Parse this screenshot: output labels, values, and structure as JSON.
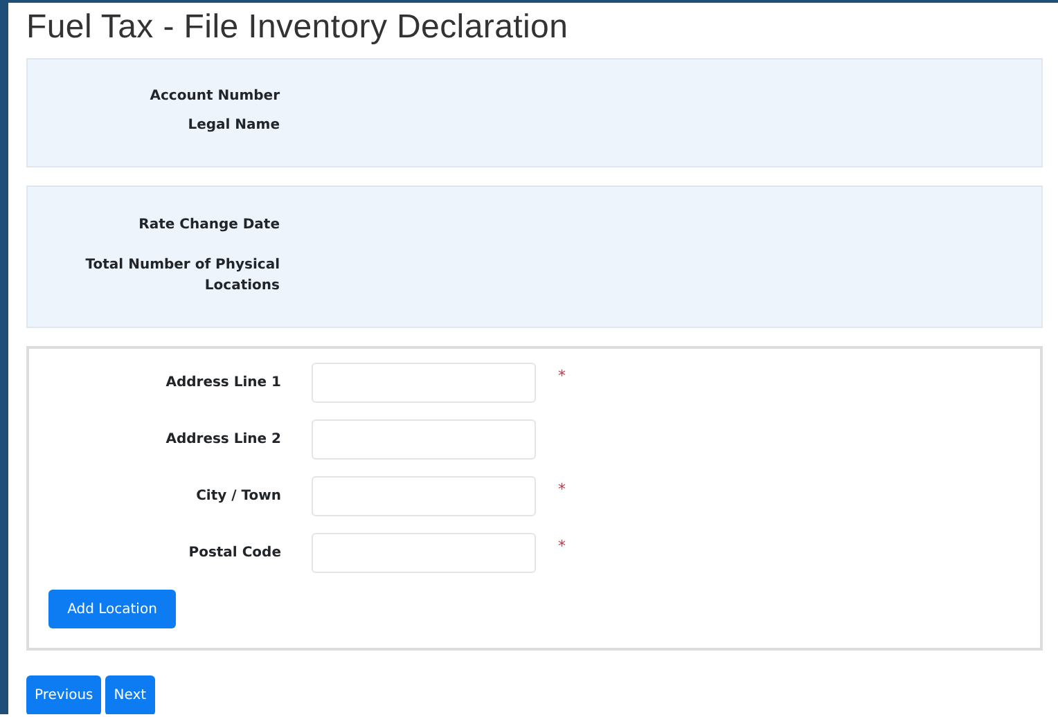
{
  "page": {
    "title": "Fuel Tax - File Inventory Declaration"
  },
  "info_panels": [
    {
      "rows": [
        {
          "label": "Account Number"
        },
        {
          "label": "Legal Name"
        }
      ]
    },
    {
      "rows": [
        {
          "label": "Rate Change Date"
        },
        {
          "label": "Total Number of Physical Locations"
        }
      ]
    }
  ],
  "location_form": {
    "fields": [
      {
        "label": "Address Line 1",
        "required": true
      },
      {
        "label": "Address Line 2",
        "required": false
      },
      {
        "label": "City / Town",
        "required": true
      },
      {
        "label": "Postal Code",
        "required": true
      }
    ],
    "required_mark": "*",
    "add_button": "Add Location"
  },
  "nav_buttons": [
    "Previous",
    "Next"
  ]
}
